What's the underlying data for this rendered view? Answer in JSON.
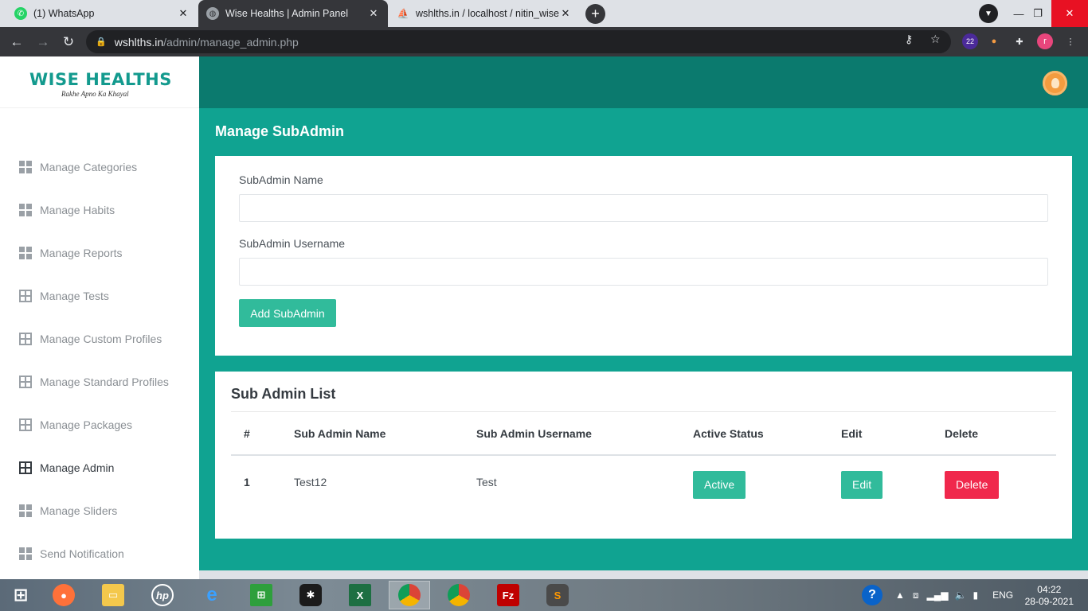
{
  "browser": {
    "tabs": [
      {
        "title": "(1) WhatsApp",
        "icon": "whatsapp-icon"
      },
      {
        "title": "Wise Healths | Admin Panel",
        "icon": "globe-icon"
      },
      {
        "title": "wshlths.in / localhost / nitin_wise",
        "icon": "phpmyadmin-icon"
      }
    ],
    "url_host": "wshlths.in",
    "url_path": "/admin/manage_admin.php",
    "extension_badge": "22",
    "profile_initial": "r"
  },
  "sidebar": {
    "logo_text": "WISE HEALTHS",
    "logo_tagline": "Rakhe Apno Ka Khayal",
    "items": [
      {
        "label": "Manage Categories",
        "icon": "dashboard-icon"
      },
      {
        "label": "Manage Habits",
        "icon": "dashboard-icon"
      },
      {
        "label": "Manage Reports",
        "icon": "dashboard-icon"
      },
      {
        "label": "Manage Tests",
        "icon": "grid-icon"
      },
      {
        "label": "Manage Custom Profiles",
        "icon": "grid-icon"
      },
      {
        "label": "Manage Standard Profiles",
        "icon": "grid-icon"
      },
      {
        "label": "Manage Packages",
        "icon": "grid-icon"
      },
      {
        "label": "Manage Admin",
        "icon": "grid-icon",
        "active": true
      },
      {
        "label": "Manage Sliders",
        "icon": "dashboard-icon"
      },
      {
        "label": "Send Notification",
        "icon": "dashboard-icon"
      }
    ]
  },
  "page": {
    "title": "Manage SubAdmin",
    "form": {
      "name_label": "SubAdmin Name",
      "name_value": "",
      "username_label": "SubAdmin Username",
      "username_value": "",
      "submit_label": "Add SubAdmin"
    },
    "list": {
      "title": "Sub Admin List",
      "columns": [
        "#",
        "Sub Admin Name",
        "Sub Admin Username",
        "Active Status",
        "Edit",
        "Delete"
      ],
      "rows": [
        {
          "num": "1",
          "name": "Test12",
          "username": "Test",
          "status": "Active",
          "edit": "Edit",
          "delete": "Delete"
        }
      ]
    }
  },
  "taskbar": {
    "apps": [
      "start-icon",
      "firefox-icon",
      "file-explorer-icon",
      "hp-icon",
      "internet-explorer-icon",
      "store-icon",
      "app-icon",
      "excel-icon",
      "chrome-profile-icon",
      "chrome-icon",
      "filezilla-icon",
      "sublime-text-icon"
    ],
    "language": "ENG",
    "time": "04:22",
    "date": "28-09-2021"
  },
  "colors": {
    "brand_teal": "#10a391",
    "header_teal": "#0b7a6e",
    "button_teal": "#31bb9b",
    "button_red": "#f0284c"
  }
}
